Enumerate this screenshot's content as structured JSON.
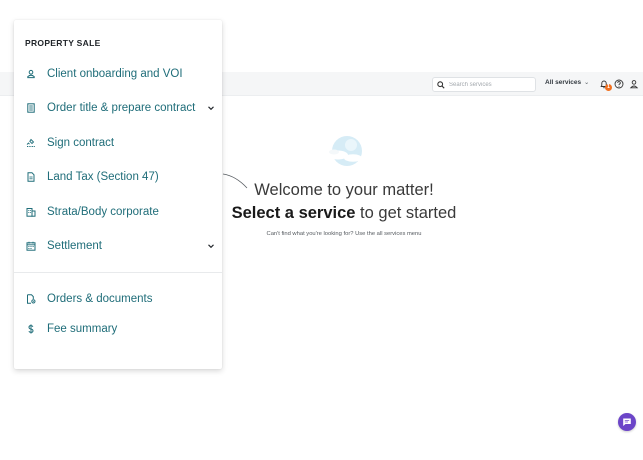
{
  "topbar": {
    "search": {
      "placeholder": "Search services",
      "value": ""
    },
    "all_services_label": "All services",
    "notifications": {
      "count": "1",
      "icon": "bell-icon"
    },
    "help_icon": "help-icon",
    "user_icon": "user-icon"
  },
  "main": {
    "welcome_line": "Welcome to your matter!",
    "cta_bold": "Select a service",
    "cta_rest": " to get started",
    "hint": "Can't find what you're looking for? Use the all services menu"
  },
  "menu": {
    "title": "PROPERTY SALE",
    "items": [
      {
        "label": "Client onboarding and VOI",
        "icon": "person-icon",
        "expandable": false
      },
      {
        "label": "Order title & prepare contract",
        "icon": "document-list-icon",
        "expandable": true
      },
      {
        "label": "Sign contract",
        "icon": "signature-icon",
        "expandable": false
      },
      {
        "label": "Land Tax (Section 47)",
        "icon": "document-icon",
        "expandable": false
      },
      {
        "label": "Strata/Body corporate",
        "icon": "building-icon",
        "expandable": false
      },
      {
        "label": "Settlement",
        "icon": "calendar-icon",
        "expandable": true
      }
    ],
    "secondary_items": [
      {
        "label": "Orders & documents",
        "icon": "document-settings-icon"
      },
      {
        "label": "Fee summary",
        "icon": "dollar-icon"
      }
    ]
  },
  "colors": {
    "accent_teal": "#1f6d79",
    "notification_badge": "#f2701f",
    "chat_button": "#6c45c8"
  }
}
